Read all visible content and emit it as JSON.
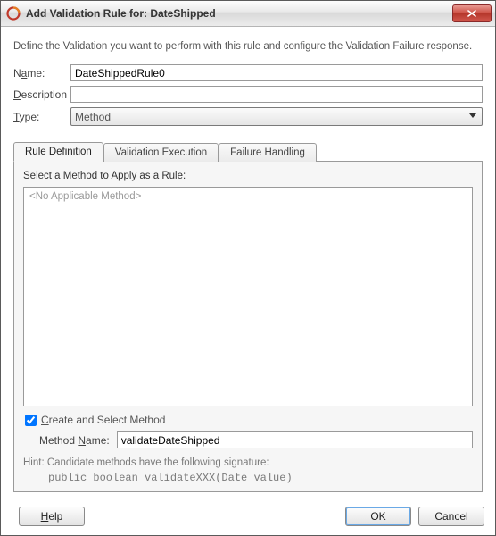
{
  "window": {
    "title": "Add Validation Rule for: DateShipped"
  },
  "intro": "Define the Validation you want to perform with this rule and configure the Validation Failure response.",
  "form": {
    "name_label_pre": "N",
    "name_label_mn": "a",
    "name_label_post": "me:",
    "name_value": "DateShippedRule0",
    "desc_label_mn": "D",
    "desc_label_post": "escription",
    "desc_value": "",
    "type_label_mn": "T",
    "type_label_post": "ype:",
    "type_value": "Method"
  },
  "tabs": {
    "t1": "Rule Definition",
    "t2": "Validation Execution",
    "t3": "Failure Handling"
  },
  "panel": {
    "select_label": "Select a Method to Apply as a Rule:",
    "placeholder": "<No Applicable Method>",
    "create_chk_pre": "",
    "create_chk_mn": "C",
    "create_chk_post": "reate and Select Method",
    "method_label_pre": "Method ",
    "method_label_mn": "N",
    "method_label_post": "ame:",
    "method_value": "validateDateShipped",
    "hint": "Hint: Candidate methods have the following signature:",
    "sig": "public boolean validateXXX(Date value)"
  },
  "buttons": {
    "help_mn": "H",
    "help_post": "elp",
    "ok": "OK",
    "cancel": "Cancel"
  }
}
